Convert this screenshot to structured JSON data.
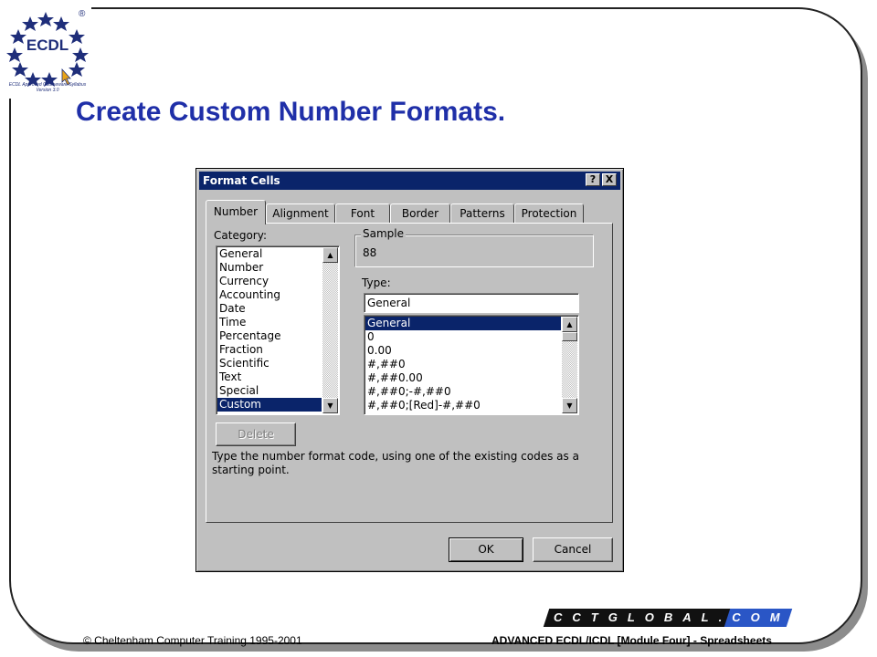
{
  "slide": {
    "title": "Create Custom Number Formats.",
    "footer_left": "© Cheltenham Computer Training 1995-2001",
    "footer_right": "ADVANCED ECDL/ICDL [Module Four]  - Spreadsheets",
    "brand_left": "CCTGLOBAL",
    "brand_right": ".COM"
  },
  "logo": {
    "text": "ECDL",
    "registered": "®",
    "subtitle": "ECDL Approved Courseware Syllabus Version 3.0"
  },
  "dialog": {
    "title": "Format Cells",
    "help_label": "?",
    "close_label": "X",
    "tabs": [
      "Number",
      "Alignment",
      "Font",
      "Border",
      "Patterns",
      "Protection"
    ],
    "active_tab": "Number",
    "category_label": "Category:",
    "categories": [
      "General",
      "Number",
      "Currency",
      "Accounting",
      "Date",
      "Time",
      "Percentage",
      "Fraction",
      "Scientific",
      "Text",
      "Special",
      "Custom"
    ],
    "selected_category": "Custom",
    "sample_label": "Sample",
    "sample_value": "88",
    "type_label": "Type:",
    "type_value": "General",
    "type_list": [
      "General",
      "0",
      "0.00",
      "#,##0",
      "#,##0.00",
      "#,##0;-#,##0",
      "#,##0;[Red]-#,##0"
    ],
    "selected_type": "General",
    "delete_label": "Delete",
    "description": "Type the number format code, using one of the existing codes as a starting point.",
    "ok_label": "OK",
    "cancel_label": "Cancel"
  },
  "colors": {
    "title": "#1f2fa8",
    "titlebar": "#0a246a",
    "dialog_face": "#c0c0c0",
    "brand_blue": "#2a56c6"
  }
}
